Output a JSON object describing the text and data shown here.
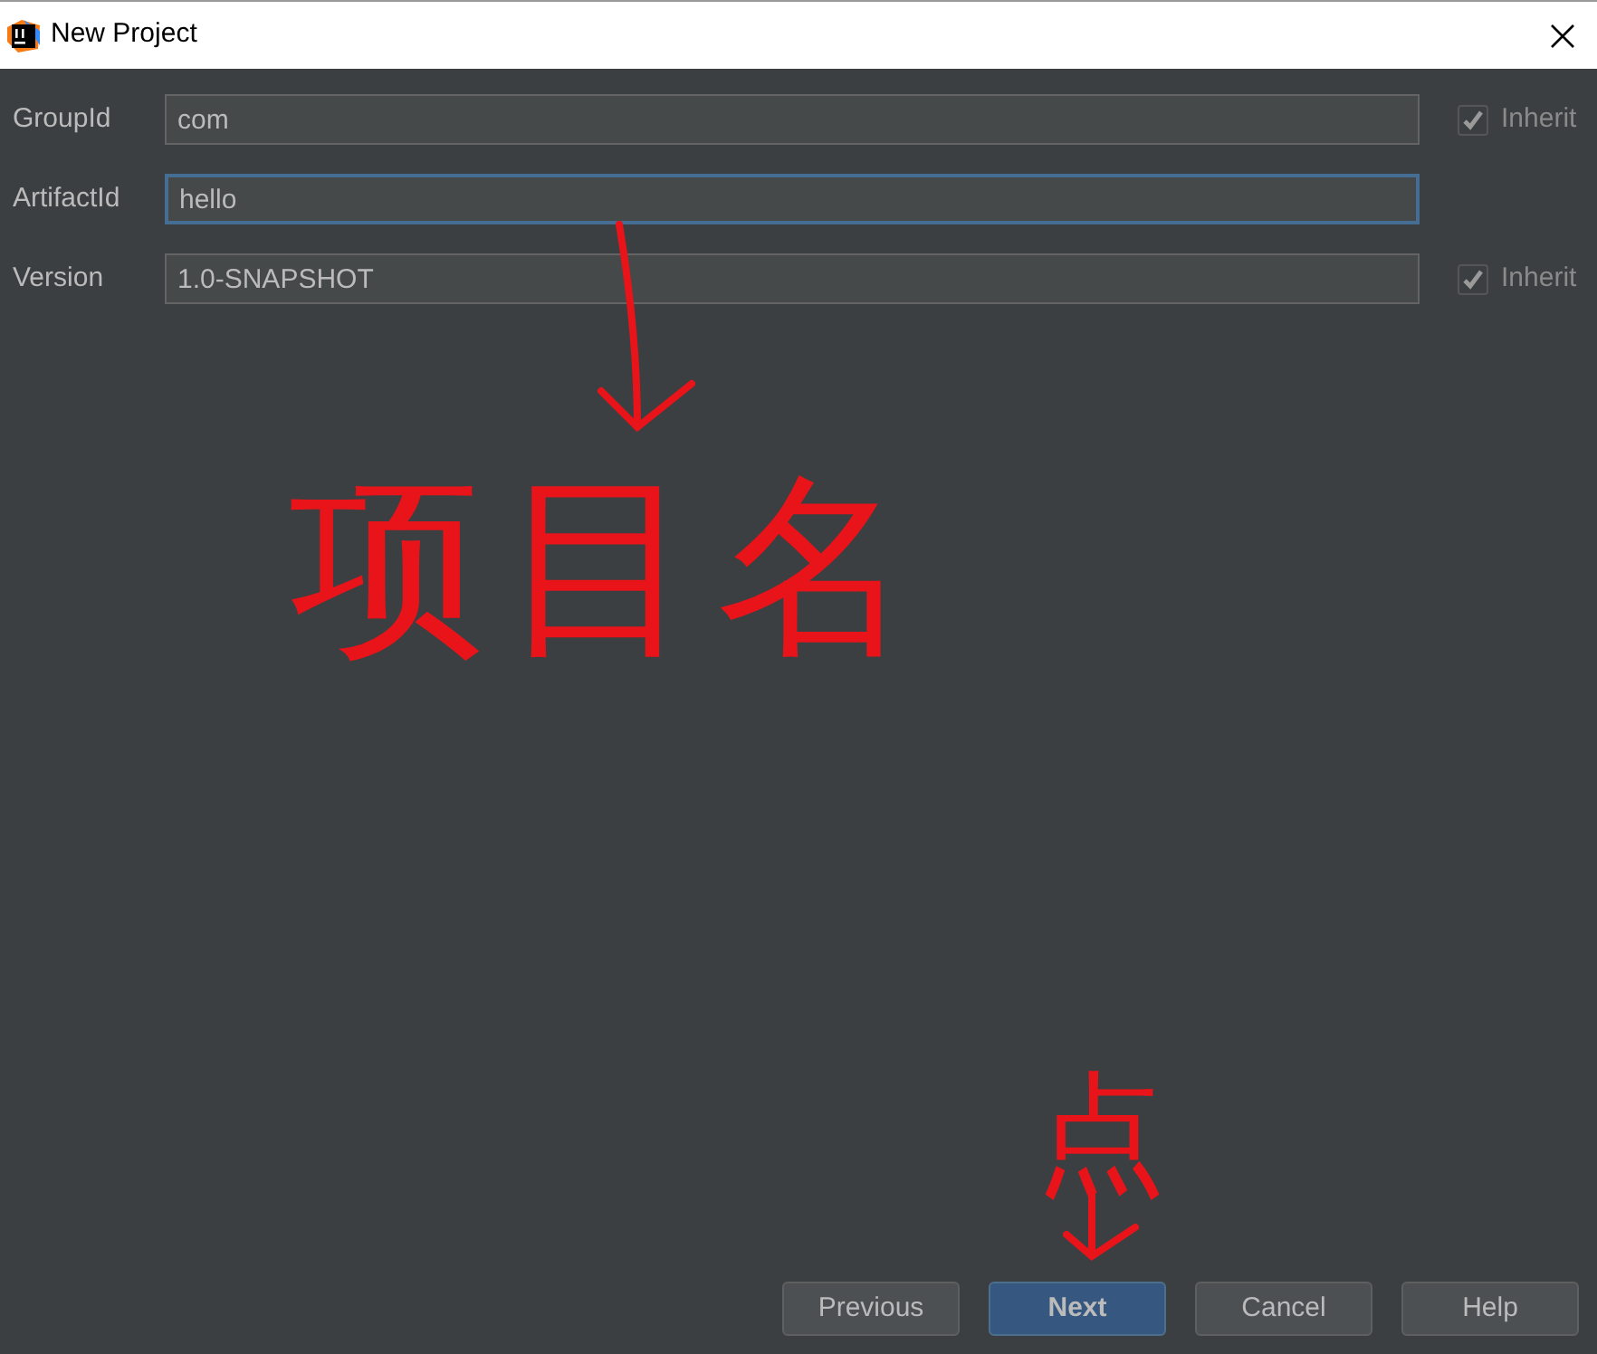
{
  "window": {
    "title": "New Project"
  },
  "fields": [
    {
      "label": "GroupId",
      "value": "com",
      "focused": false,
      "inherit": {
        "label": "Inherit",
        "checked": true,
        "disabled": true
      }
    },
    {
      "label": "ArtifactId",
      "value": "hello",
      "focused": true
    },
    {
      "label": "Version",
      "value": "1.0-SNAPSHOT",
      "focused": false,
      "inherit": {
        "label": "Inherit",
        "checked": true,
        "disabled": true
      }
    }
  ],
  "annotations": [
    {
      "kind": "arrow"
    },
    {
      "kind": "text",
      "text": "项目名"
    },
    {
      "kind": "text",
      "text": "点"
    },
    {
      "kind": "arrow"
    }
  ],
  "buttons": [
    {
      "label": "Previous",
      "default": false
    },
    {
      "label": "Next",
      "default": true
    },
    {
      "label": "Cancel",
      "default": false
    },
    {
      "label": "Help",
      "default": false
    }
  ]
}
